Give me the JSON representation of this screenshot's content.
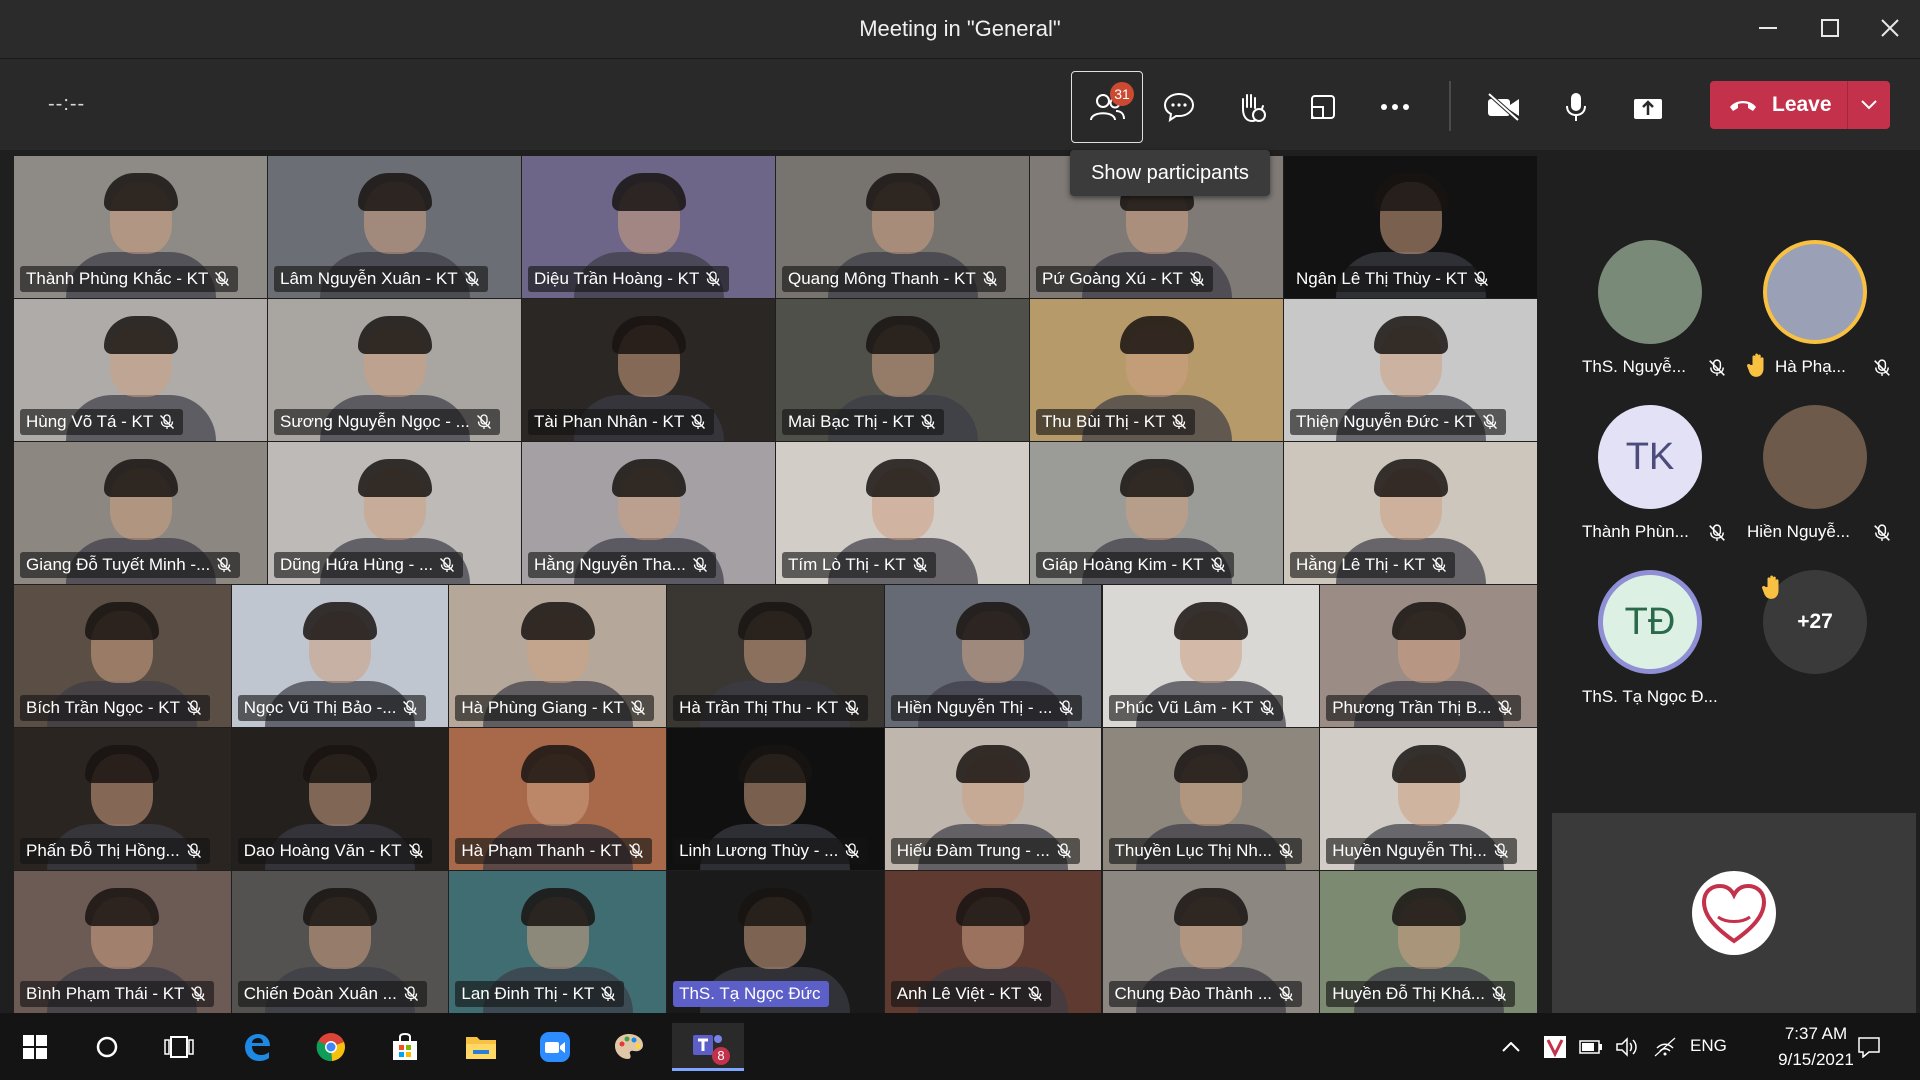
{
  "window": {
    "title": "Meeting in \"General\""
  },
  "toolbar": {
    "timer": "--:--",
    "participants_count": "31",
    "tooltip": "Show participants",
    "leave_label": "Leave"
  },
  "grid": {
    "tiles": [
      {
        "name": "Thành Phùng Khắc - KT",
        "bg": "#8e8a86"
      },
      {
        "name": "Lâm Nguyễn Xuân - KT",
        "bg": "#6b6e74"
      },
      {
        "name": "Diệu Trần Hoàng - KT",
        "bg": "#6e6688"
      },
      {
        "name": "Quang Mông Thanh - KT",
        "bg": "#77736f"
      },
      {
        "name": "Pứ Goàng Xú - KT",
        "bg": "#7f7a76"
      },
      {
        "name": "Ngân Lê Thị Thùy - KT",
        "bg": "#121212"
      },
      {
        "name": "Hùng Võ Tá - KT",
        "bg": "#aeaba8"
      },
      {
        "name": "Sương Nguyễn Ngọc - ...",
        "bg": "#a9a5a0"
      },
      {
        "name": "Tài Phan Nhân - KT",
        "bg": "#2a2724"
      },
      {
        "name": "Mai Bạc Thị - KT",
        "bg": "#4f504a"
      },
      {
        "name": "Thu Bùi Thị - KT",
        "bg": "#b79a6a"
      },
      {
        "name": "Thiện Nguyễn Đức - KT",
        "bg": "#c8c8c8"
      },
      {
        "name": "Giang Đỗ Tuyết Minh -...",
        "bg": "#8d8782"
      },
      {
        "name": "Dũng Hứa Hùng - ...",
        "bg": "#bdbab7"
      },
      {
        "name": "Hằng Nguyễn Tha...",
        "bg": "#a4a0a3"
      },
      {
        "name": "Tím Lò Thị - KT",
        "bg": "#d3cdc7"
      },
      {
        "name": "Giáp Hoàng Kim - KT",
        "bg": "#9b9c98"
      },
      {
        "name": "Hằng Lê Thị - KT",
        "bg": "#cdc6bc"
      },
      {
        "name": "Bích Trần Ngọc - KT",
        "bg": "#5a4e45"
      },
      {
        "name": "Ngọc Vũ Thị Bảo -...",
        "bg": "#bfc6cf"
      },
      {
        "name": "Hà Phùng Giang - KT",
        "bg": "#b5a89a"
      },
      {
        "name": "Hà Trần Thị Thu - KT",
        "bg": "#3a3632"
      },
      {
        "name": "Hiền Nguyễn Thị - ...",
        "bg": "#666a75"
      },
      {
        "name": "Phúc Vũ Lâm - KT",
        "bg": "#d9d8d4"
      },
      {
        "name": "Phương Trần Thị B...",
        "bg": "#9b8d86"
      },
      {
        "name": "Phấn Đỗ Thị Hồng...",
        "bg": "#2b2521"
      },
      {
        "name": "Dao Hoàng Văn - KT",
        "bg": "#23201e"
      },
      {
        "name": "Hà Phạm Thanh - KT",
        "bg": "#a7694a"
      },
      {
        "name": "Linh Lương Thùy - ...",
        "bg": "#101010"
      },
      {
        "name": "Hiếu Đàm Trung - ...",
        "bg": "#bfb7ae"
      },
      {
        "name": "Thuyền Lục Thị Nh...",
        "bg": "#8d877d"
      },
      {
        "name": "Huyền Nguyễn Thị...",
        "bg": "#d1cdc6"
      },
      {
        "name": "Bình Phạm Thái - KT",
        "bg": "#6c5a54"
      },
      {
        "name": "Chiến Đoàn Xuân ...",
        "bg": "#535250"
      },
      {
        "name": "Lan Đinh Thị - KT",
        "bg": "#3f6d72"
      },
      {
        "name": "ThS. Tạ Ngọc Đức",
        "bg": "#1a1a1a",
        "host": true
      },
      {
        "name": "Anh Lê Việt - KT",
        "bg": "#5e3a31"
      },
      {
        "name": "Chung Đào Thành ...",
        "bg": "#8c8780"
      },
      {
        "name": "Huyền Đỗ Thị Khá...",
        "bg": "#7c8a72"
      }
    ]
  },
  "side_participants": [
    {
      "name": "ThS. Nguyễ...",
      "initials": "",
      "bg": "#7a8a78",
      "raised": false
    },
    {
      "name": "Hà Phạ...",
      "initials": "",
      "bg": "#9aa0b5",
      "raised": true
    },
    {
      "name": "Thành Phùn...",
      "initials": "TK",
      "bg": "#e3e1f5",
      "raised": false
    },
    {
      "name": "Hiền Nguyễ...",
      "initials": "",
      "bg": "#6d5a4a",
      "raised": false
    },
    {
      "name": "ThS. Tạ Ngọc Đ...",
      "initials": "TĐ",
      "bg": "#dcf0e4",
      "raised": false
    }
  ],
  "overflow_count": "+27",
  "taskbar": {
    "language": "ENG",
    "time": "7:37 AM",
    "date": "9/15/2021",
    "teams_badge": "8"
  },
  "colors": {
    "accent": "#5b5fc7",
    "leave": "#c4314b",
    "badge": "#cc4a31",
    "raised_hand": "#f8c142"
  }
}
